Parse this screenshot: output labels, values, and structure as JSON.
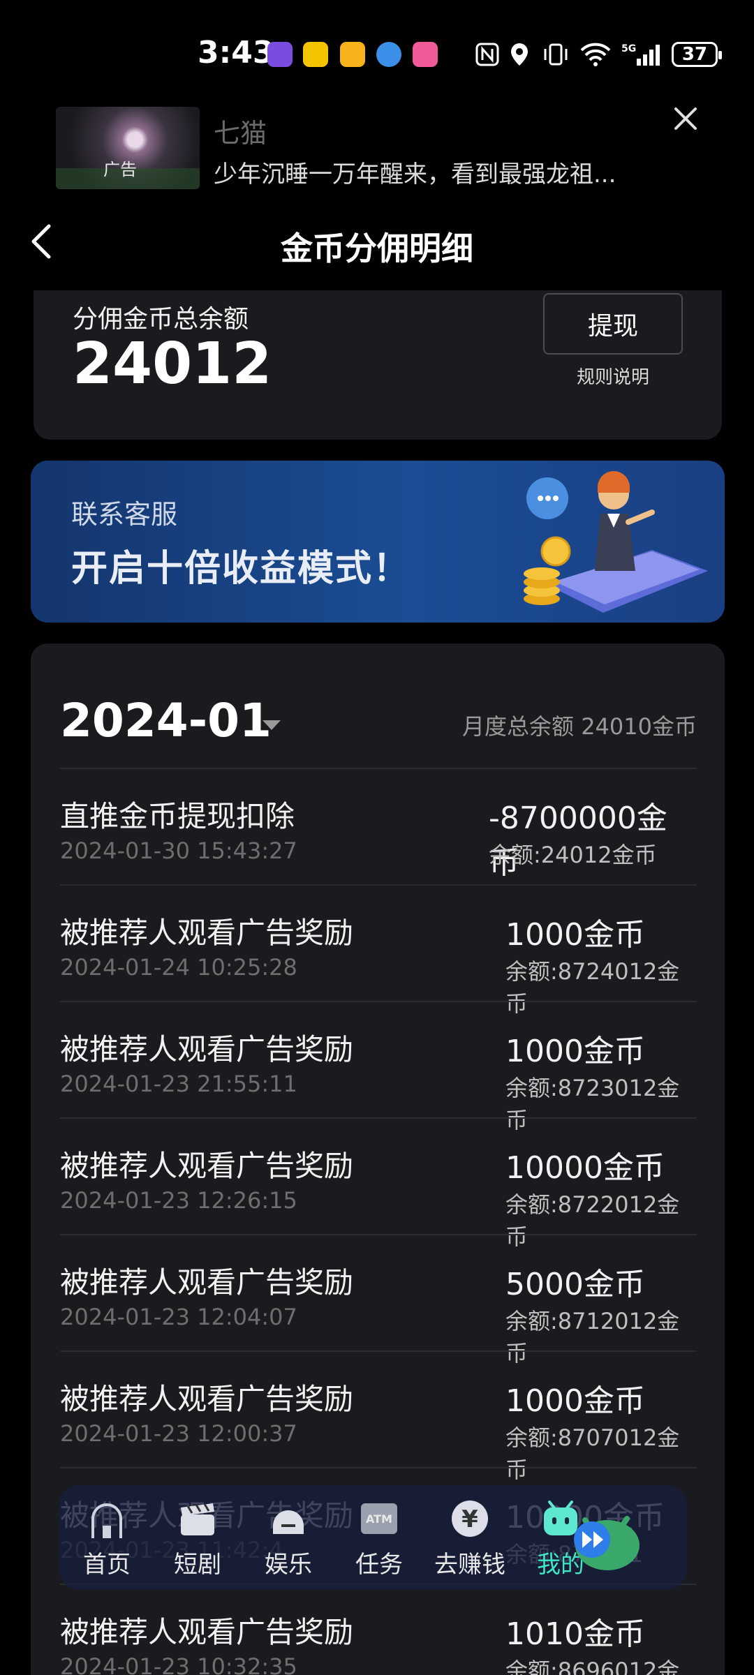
{
  "status_bar": {
    "time": "3:43",
    "battery": "37",
    "network": "5G"
  },
  "ad": {
    "thumb_tag": "广告",
    "app_name": "七猫",
    "description": "少年沉睡一万年醒来，看到最强龙祖..."
  },
  "header": {
    "title": "金币分佣明细"
  },
  "balance": {
    "label": "分佣金币总余额",
    "value": "24012",
    "withdraw_label": "提现",
    "rules_label": "规则说明"
  },
  "promo": {
    "subtitle": "联系客服",
    "headline": "开启十倍收益模式！"
  },
  "records": {
    "month": "2024-01",
    "month_total": "月度总余额 24010金币",
    "items": [
      {
        "title": "直推金币提现扣除",
        "time": "2024-01-30 15:43:27",
        "amount": "-8700000金币",
        "balance": "余额:24012金币"
      },
      {
        "title": "被推荐人观看广告奖励",
        "time": "2024-01-24 10:25:28",
        "amount": "1000金币",
        "balance": "余额:8724012金币"
      },
      {
        "title": "被推荐人观看广告奖励",
        "time": "2024-01-23 21:55:11",
        "amount": "1000金币",
        "balance": "余额:8723012金币"
      },
      {
        "title": "被推荐人观看广告奖励",
        "time": "2024-01-23 12:26:15",
        "amount": "10000金币",
        "balance": "余额:8722012金币"
      },
      {
        "title": "被推荐人观看广告奖励",
        "time": "2024-01-23 12:04:07",
        "amount": "5000金币",
        "balance": "余额:8712012金币"
      },
      {
        "title": "被推荐人观看广告奖励",
        "time": "2024-01-23 12:00:37",
        "amount": "1000金币",
        "balance": "余额:8707012金币"
      },
      {
        "title": "被推荐人观看广告奖励",
        "time": "2024-01-23 11:42:4",
        "amount": "10000金币",
        "balance": "余额:870601"
      },
      {
        "title": "被推荐人观看广告奖励",
        "time": "2024-01-23 10:32:35",
        "amount": "1010金币",
        "balance": "余额:8696012金币"
      }
    ]
  },
  "nav": {
    "items": [
      {
        "label": "首页",
        "icon": "home-icon"
      },
      {
        "label": "短剧",
        "icon": "clapperboard-icon"
      },
      {
        "label": "娱乐",
        "icon": "game-icon"
      },
      {
        "label": "任务",
        "icon": "atm-icon"
      },
      {
        "label": "去赚钱",
        "icon": "yuan-icon"
      },
      {
        "label": "我的",
        "icon": "robot-icon"
      }
    ],
    "atm_text": "ATM",
    "yuan_symbol": "¥",
    "active_color": "#3ee6c8"
  }
}
